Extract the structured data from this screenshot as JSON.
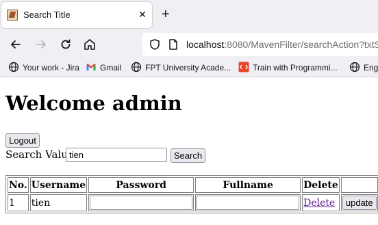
{
  "browser": {
    "tab_title": "Search Title",
    "tab_close": "✕",
    "new_tab": "+",
    "url_host": "localhost",
    "url_rest": ":8080/MavenFilter/searchAction?txtS",
    "bookmarks": [
      {
        "label": "Your work - Jira",
        "icon": "globe-icon"
      },
      {
        "label": "Gmail",
        "icon": "gmail-icon"
      },
      {
        "label": "FPT University Acade...",
        "icon": "globe-icon"
      },
      {
        "label": "Train with Programmi...",
        "icon": "code-icon"
      },
      {
        "label": "Engi",
        "icon": "globe-icon"
      }
    ]
  },
  "page": {
    "heading": "Welcome admin",
    "logout_label": "Logout",
    "search_label": "Search Value",
    "search_value": "tien",
    "search_button": "Search"
  },
  "table": {
    "headers": [
      "No.",
      "Username",
      "Password",
      "Fullname",
      "Delete"
    ],
    "rows": [
      {
        "no": "1",
        "username": "tien",
        "password": "",
        "fullname": "",
        "delete_label": "Delete",
        "update_label": "update"
      }
    ]
  },
  "colors": {
    "link_visited": "#551a8b",
    "chrome_bg": "#f0f0f4"
  }
}
